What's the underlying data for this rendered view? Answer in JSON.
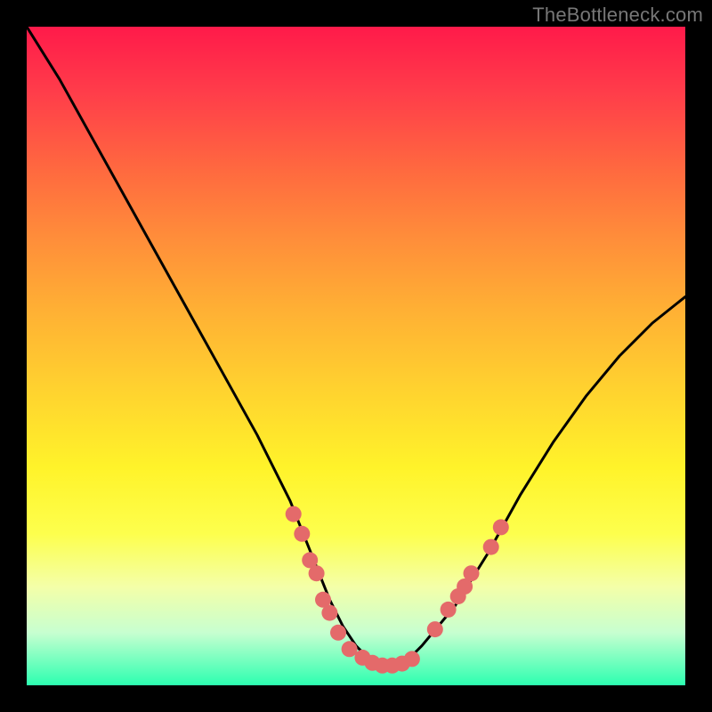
{
  "watermark": "TheBottleneck.com",
  "palette": {
    "curve_stroke": "#000000",
    "dot_fill": "#e46a6a",
    "dot_stroke": "#c94f4f"
  },
  "chart_data": {
    "type": "line",
    "title": "",
    "xlabel": "",
    "ylabel": "",
    "xlim": [
      0,
      100
    ],
    "ylim": [
      0,
      100
    ],
    "series": [
      {
        "name": "bottleneck-curve",
        "x": [
          0,
          5,
          10,
          15,
          20,
          25,
          30,
          35,
          40,
          42,
          44,
          46,
          48,
          50,
          52,
          54,
          56,
          58,
          60,
          65,
          70,
          75,
          80,
          85,
          90,
          95,
          100
        ],
        "y": [
          100,
          92,
          83,
          74,
          65,
          56,
          47,
          38,
          28,
          23,
          18,
          13,
          9,
          6,
          4,
          3,
          3,
          4,
          6,
          12,
          20,
          29,
          37,
          44,
          50,
          55,
          59
        ]
      }
    ],
    "dots": [
      {
        "x": 40.5,
        "y": 26
      },
      {
        "x": 41.8,
        "y": 23
      },
      {
        "x": 43.0,
        "y": 19
      },
      {
        "x": 44.0,
        "y": 17
      },
      {
        "x": 45.0,
        "y": 13
      },
      {
        "x": 46.0,
        "y": 11
      },
      {
        "x": 47.3,
        "y": 8
      },
      {
        "x": 49.0,
        "y": 5.5
      },
      {
        "x": 51.0,
        "y": 4.2
      },
      {
        "x": 52.5,
        "y": 3.4
      },
      {
        "x": 54.0,
        "y": 3.0
      },
      {
        "x": 55.5,
        "y": 3.0
      },
      {
        "x": 57.0,
        "y": 3.3
      },
      {
        "x": 58.5,
        "y": 4.0
      },
      {
        "x": 62.0,
        "y": 8.5
      },
      {
        "x": 64.0,
        "y": 11.5
      },
      {
        "x": 65.5,
        "y": 13.5
      },
      {
        "x": 66.5,
        "y": 15
      },
      {
        "x": 67.5,
        "y": 17
      },
      {
        "x": 70.5,
        "y": 21
      },
      {
        "x": 72.0,
        "y": 24
      }
    ]
  }
}
